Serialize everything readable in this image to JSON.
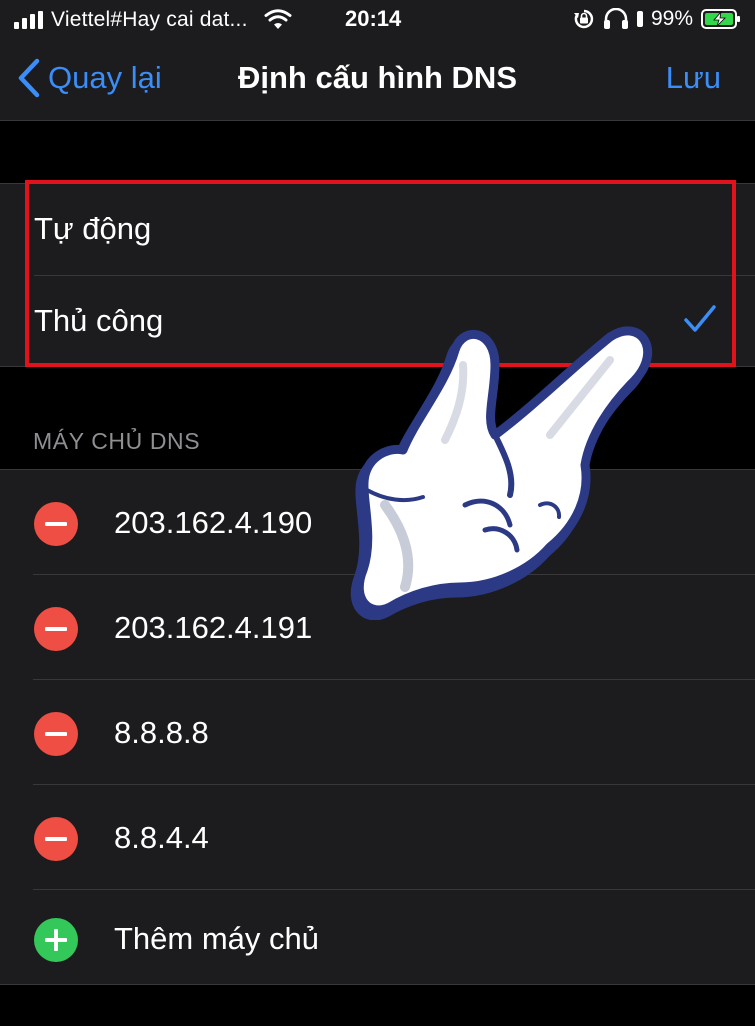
{
  "status_bar": {
    "carrier": "Viettel#Hay cai dat...",
    "time": "20:14",
    "battery": "99%"
  },
  "nav": {
    "back_label": "Quay lại",
    "title": "Định cấu hình DNS",
    "save_label": "Lưu"
  },
  "mode": {
    "options": [
      {
        "label": "Tự động",
        "selected": false
      },
      {
        "label": "Thủ công",
        "selected": true
      }
    ]
  },
  "dns": {
    "header": "MÁY CHỦ DNS",
    "servers": [
      "203.162.4.190",
      "203.162.4.191",
      "8.8.8.8",
      "8.8.4.4"
    ],
    "add_label": "Thêm máy chủ"
  },
  "icons": {
    "back": "chevron-left-icon",
    "check": "checkmark-icon",
    "remove": "minus-circle-icon",
    "add": "plus-circle-icon"
  },
  "colors": {
    "accent": "#3b8df7",
    "background": "#000000",
    "cell": "#1c1c1e",
    "remove": "#ef4e44",
    "add": "#34c759",
    "highlight": "#e0121b"
  }
}
